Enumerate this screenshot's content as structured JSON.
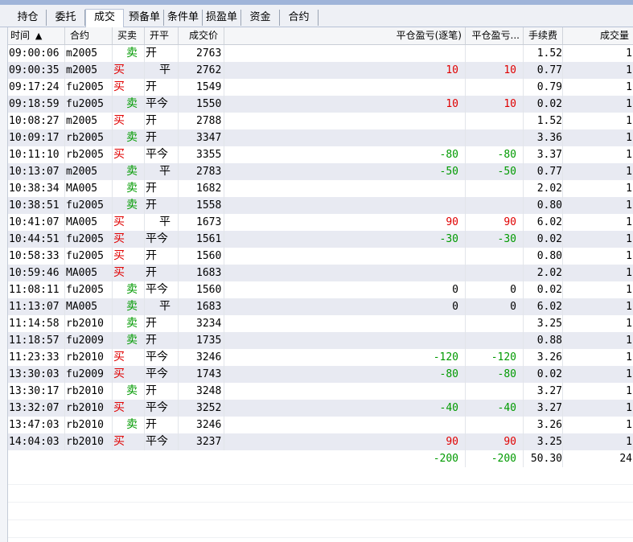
{
  "tabs": [
    "持仓",
    "委托",
    "成交",
    "预备单",
    "条件单",
    "损盈单",
    "资金",
    "合约"
  ],
  "active_tab": 2,
  "headers": {
    "time": "时间",
    "sort_arrow": "▲",
    "contract": "合约",
    "side": "买卖",
    "openclose": "开平",
    "price": "成交价",
    "pnl_trade": "平仓盈亏(逐笔)",
    "pnl_mark": "平仓盈亏...",
    "fee": "手续费",
    "qty": "成交量"
  },
  "colors": {
    "buy": "#e00000",
    "sell": "#009a00",
    "positive": "#e00000",
    "negative": "#009a00",
    "row_alt": "#e8eaf2"
  },
  "rows": [
    {
      "time": "09:00:06",
      "contract": "m2005",
      "side": "卖",
      "oc": "开",
      "price": "2763",
      "p1": "",
      "p2": "",
      "fee": "1.52",
      "qty": "1"
    },
    {
      "time": "09:00:35",
      "contract": "m2005",
      "side": "买",
      "oc": "平",
      "price": "2762",
      "p1": "10",
      "p2": "10",
      "fee": "0.77",
      "qty": "1"
    },
    {
      "time": "09:17:24",
      "contract": "fu2005",
      "side": "买",
      "oc": "开",
      "price": "1549",
      "p1": "",
      "p2": "",
      "fee": "0.79",
      "qty": "1"
    },
    {
      "time": "09:18:59",
      "contract": "fu2005",
      "side": "卖",
      "oc": "平今",
      "price": "1550",
      "p1": "10",
      "p2": "10",
      "fee": "0.02",
      "qty": "1"
    },
    {
      "time": "10:08:27",
      "contract": "m2005",
      "side": "买",
      "oc": "开",
      "price": "2788",
      "p1": "",
      "p2": "",
      "fee": "1.52",
      "qty": "1"
    },
    {
      "time": "10:09:17",
      "contract": "rb2005",
      "side": "卖",
      "oc": "开",
      "price": "3347",
      "p1": "",
      "p2": "",
      "fee": "3.36",
      "qty": "1"
    },
    {
      "time": "10:11:10",
      "contract": "rb2005",
      "side": "买",
      "oc": "平今",
      "price": "3355",
      "p1": "-80",
      "p2": "-80",
      "fee": "3.37",
      "qty": "1"
    },
    {
      "time": "10:13:07",
      "contract": "m2005",
      "side": "卖",
      "oc": "平",
      "price": "2783",
      "p1": "-50",
      "p2": "-50",
      "fee": "0.77",
      "qty": "1"
    },
    {
      "time": "10:38:34",
      "contract": "MA005",
      "side": "卖",
      "oc": "开",
      "price": "1682",
      "p1": "",
      "p2": "",
      "fee": "2.02",
      "qty": "1"
    },
    {
      "time": "10:38:51",
      "contract": "fu2005",
      "side": "卖",
      "oc": "开",
      "price": "1558",
      "p1": "",
      "p2": "",
      "fee": "0.80",
      "qty": "1"
    },
    {
      "time": "10:41:07",
      "contract": "MA005",
      "side": "买",
      "oc": "平",
      "price": "1673",
      "p1": "90",
      "p2": "90",
      "fee": "6.02",
      "qty": "1"
    },
    {
      "time": "10:44:51",
      "contract": "fu2005",
      "side": "买",
      "oc": "平今",
      "price": "1561",
      "p1": "-30",
      "p2": "-30",
      "fee": "0.02",
      "qty": "1"
    },
    {
      "time": "10:58:33",
      "contract": "fu2005",
      "side": "买",
      "oc": "开",
      "price": "1560",
      "p1": "",
      "p2": "",
      "fee": "0.80",
      "qty": "1"
    },
    {
      "time": "10:59:46",
      "contract": "MA005",
      "side": "买",
      "oc": "开",
      "price": "1683",
      "p1": "",
      "p2": "",
      "fee": "2.02",
      "qty": "1"
    },
    {
      "time": "11:08:11",
      "contract": "fu2005",
      "side": "卖",
      "oc": "平今",
      "price": "1560",
      "p1": "0",
      "p2": "0",
      "fee": "0.02",
      "qty": "1"
    },
    {
      "time": "11:13:07",
      "contract": "MA005",
      "side": "卖",
      "oc": "平",
      "price": "1683",
      "p1": "0",
      "p2": "0",
      "fee": "6.02",
      "qty": "1"
    },
    {
      "time": "11:14:58",
      "contract": "rb2010",
      "side": "卖",
      "oc": "开",
      "price": "3234",
      "p1": "",
      "p2": "",
      "fee": "3.25",
      "qty": "1"
    },
    {
      "time": "11:18:57",
      "contract": "fu2009",
      "side": "卖",
      "oc": "开",
      "price": "1735",
      "p1": "",
      "p2": "",
      "fee": "0.88",
      "qty": "1"
    },
    {
      "time": "11:23:33",
      "contract": "rb2010",
      "side": "买",
      "oc": "平今",
      "price": "3246",
      "p1": "-120",
      "p2": "-120",
      "fee": "3.26",
      "qty": "1"
    },
    {
      "time": "13:30:03",
      "contract": "fu2009",
      "side": "买",
      "oc": "平今",
      "price": "1743",
      "p1": "-80",
      "p2": "-80",
      "fee": "0.02",
      "qty": "1"
    },
    {
      "time": "13:30:17",
      "contract": "rb2010",
      "side": "卖",
      "oc": "开",
      "price": "3248",
      "p1": "",
      "p2": "",
      "fee": "3.27",
      "qty": "1"
    },
    {
      "time": "13:32:07",
      "contract": "rb2010",
      "side": "买",
      "oc": "平今",
      "price": "3252",
      "p1": "-40",
      "p2": "-40",
      "fee": "3.27",
      "qty": "1"
    },
    {
      "time": "13:47:03",
      "contract": "rb2010",
      "side": "卖",
      "oc": "开",
      "price": "3246",
      "p1": "",
      "p2": "",
      "fee": "3.26",
      "qty": "1"
    },
    {
      "time": "14:04:03",
      "contract": "rb2010",
      "side": "买",
      "oc": "平今",
      "price": "3237",
      "p1": "90",
      "p2": "90",
      "fee": "3.25",
      "qty": "1"
    }
  ],
  "totals": {
    "p1": "-200",
    "p2": "-200",
    "fee": "50.30",
    "qty": "24"
  }
}
